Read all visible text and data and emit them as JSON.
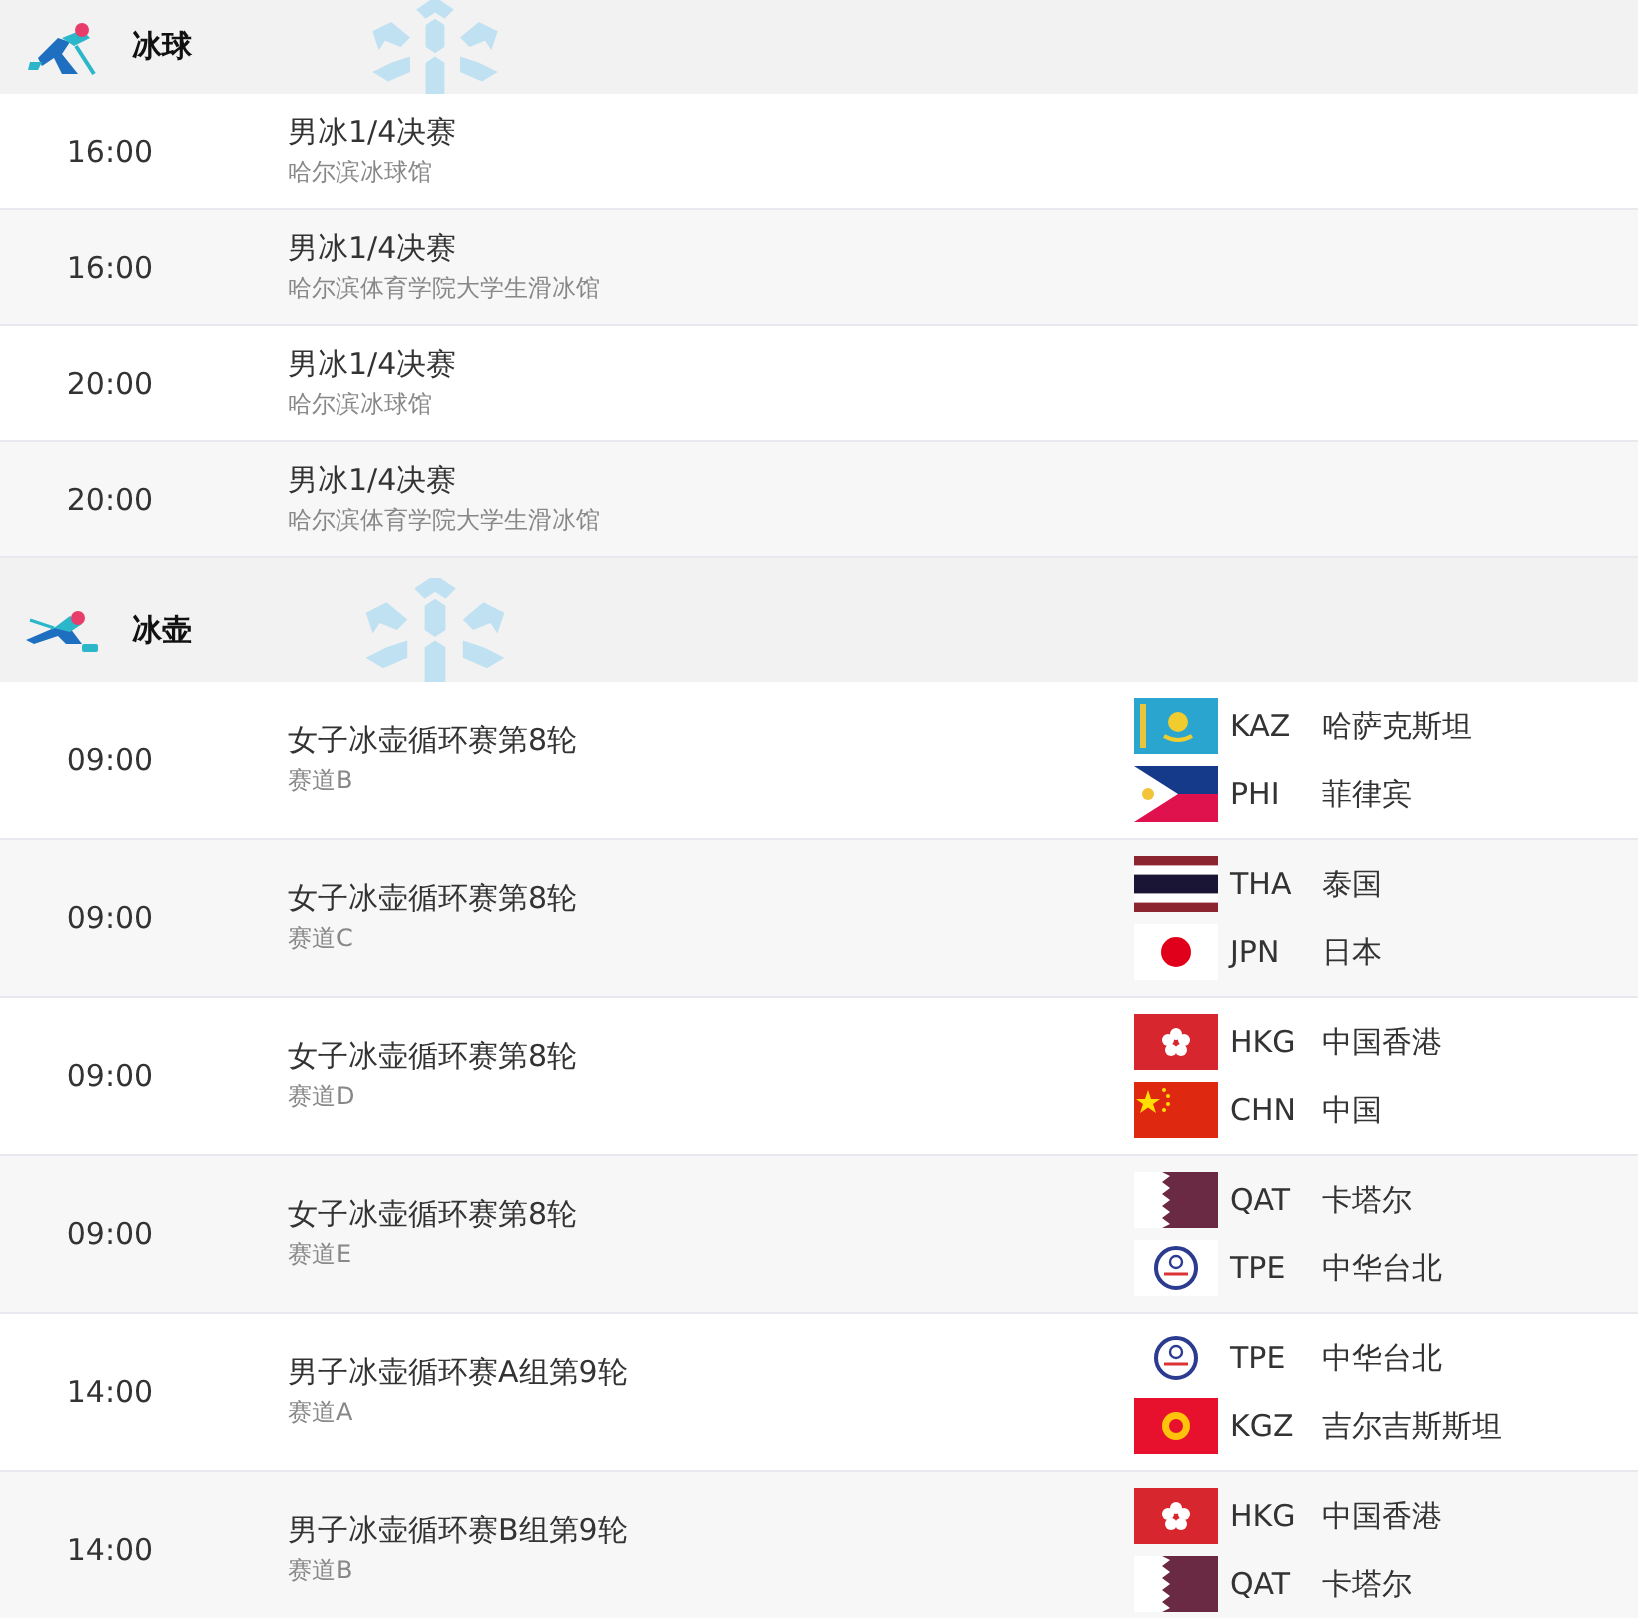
{
  "sections": [
    {
      "sport": "冰球",
      "kind": "hockey",
      "events": [
        {
          "time": "16:00",
          "title": "男冰1/4决赛",
          "venue": "哈尔滨冰球馆"
        },
        {
          "time": "16:00",
          "title": "男冰1/4决赛",
          "venue": "哈尔滨体育学院大学生滑冰馆"
        },
        {
          "time": "20:00",
          "title": "男冰1/4决赛",
          "venue": "哈尔滨冰球馆"
        },
        {
          "time": "20:00",
          "title": "男冰1/4决赛",
          "venue": "哈尔滨体育学院大学生滑冰馆"
        }
      ]
    },
    {
      "sport": "冰壶",
      "kind": "curling",
      "events": [
        {
          "time": "09:00",
          "title": "女子冰壶循环赛第8轮",
          "venue": "赛道B",
          "teams": [
            {
              "kind": "kaz",
              "code": "KAZ",
              "name": "哈萨克斯坦"
            },
            {
              "kind": "phi",
              "code": "PHI",
              "name": "菲律宾"
            }
          ]
        },
        {
          "time": "09:00",
          "title": "女子冰壶循环赛第8轮",
          "venue": "赛道C",
          "teams": [
            {
              "kind": "tha",
              "code": "THA",
              "name": "泰国"
            },
            {
              "kind": "jpn",
              "code": "JPN",
              "name": "日本"
            }
          ]
        },
        {
          "time": "09:00",
          "title": "女子冰壶循环赛第8轮",
          "venue": "赛道D",
          "teams": [
            {
              "kind": "hkg",
              "code": "HKG",
              "name": "中国香港"
            },
            {
              "kind": "chn",
              "code": "CHN",
              "name": "中国"
            }
          ]
        },
        {
          "time": "09:00",
          "title": "女子冰壶循环赛第8轮",
          "venue": "赛道E",
          "teams": [
            {
              "kind": "qat",
              "code": "QAT",
              "name": "卡塔尔"
            },
            {
              "kind": "tpe",
              "code": "TPE",
              "name": "中华台北"
            }
          ]
        },
        {
          "time": "14:00",
          "title": "男子冰壶循环赛A组第9轮",
          "venue": "赛道A",
          "teams": [
            {
              "kind": "tpe",
              "code": "TPE",
              "name": "中华台北"
            },
            {
              "kind": "kgz",
              "code": "KGZ",
              "name": "吉尔吉斯斯坦"
            }
          ]
        },
        {
          "time": "14:00",
          "title": "男子冰壶循环赛B组第9轮",
          "venue": "赛道B",
          "teams": [
            {
              "kind": "hkg",
              "code": "HKG",
              "name": "中国香港"
            },
            {
              "kind": "qat",
              "code": "QAT",
              "name": "卡塔尔"
            }
          ]
        }
      ]
    }
  ]
}
